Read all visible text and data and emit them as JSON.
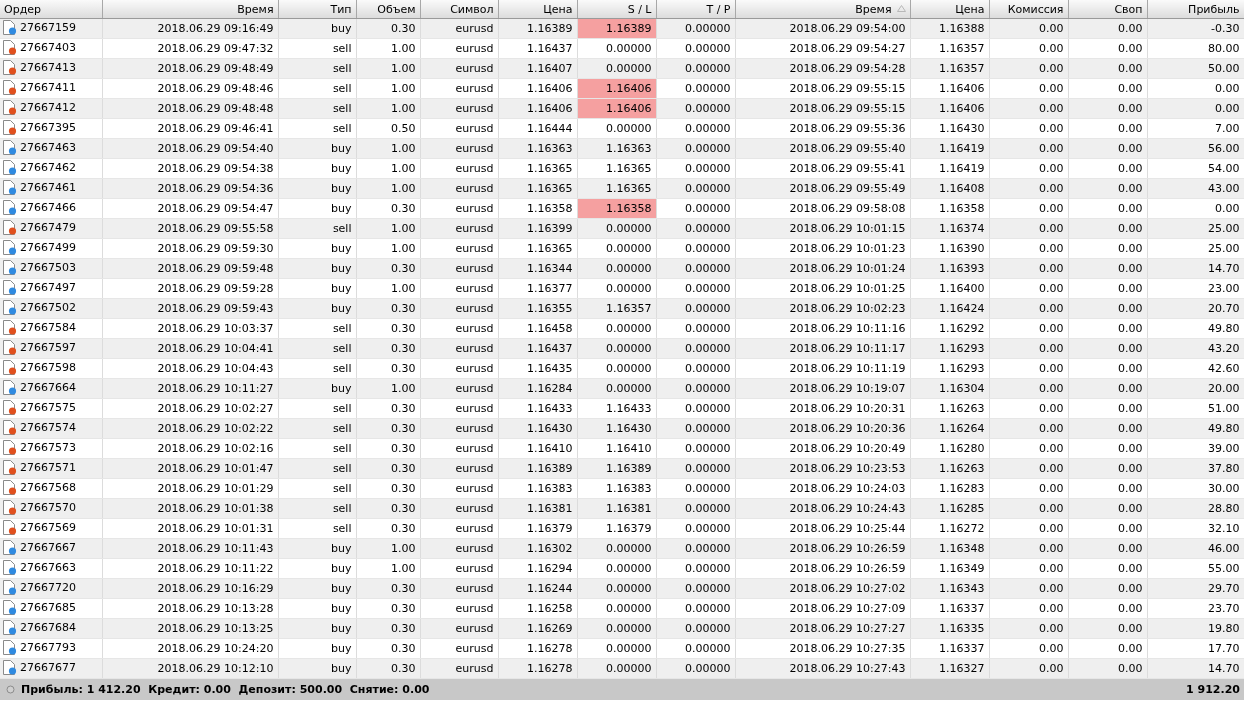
{
  "table": {
    "columns": [
      {
        "label": "Ордер",
        "sorted": false
      },
      {
        "label": "Время",
        "sorted": false
      },
      {
        "label": "Тип",
        "sorted": false
      },
      {
        "label": "Объем",
        "sorted": false
      },
      {
        "label": "Символ",
        "sorted": false
      },
      {
        "label": "Цена",
        "sorted": false
      },
      {
        "label": "S / L",
        "sorted": false
      },
      {
        "label": "T / P",
        "sorted": false
      },
      {
        "label": "Время",
        "sorted": true
      },
      {
        "label": "Цена",
        "sorted": false
      },
      {
        "label": "Комиссия",
        "sorted": false
      },
      {
        "label": "Своп",
        "sorted": false
      },
      {
        "label": "Прибыль",
        "sorted": false
      }
    ],
    "rows": [
      {
        "kind": "buy",
        "sl_hit": true,
        "cells": [
          "27667159",
          "2018.06.29 09:16:49",
          "buy",
          "0.30",
          "eurusd",
          "1.16389",
          "1.16389",
          "0.00000",
          "2018.06.29 09:54:00",
          "1.16388",
          "0.00",
          "0.00",
          "-0.30"
        ]
      },
      {
        "kind": "sell",
        "sl_hit": false,
        "cells": [
          "27667403",
          "2018.06.29 09:47:32",
          "sell",
          "1.00",
          "eurusd",
          "1.16437",
          "0.00000",
          "0.00000",
          "2018.06.29 09:54:27",
          "1.16357",
          "0.00",
          "0.00",
          "80.00"
        ]
      },
      {
        "kind": "sell",
        "sl_hit": false,
        "cells": [
          "27667413",
          "2018.06.29 09:48:49",
          "sell",
          "1.00",
          "eurusd",
          "1.16407",
          "0.00000",
          "0.00000",
          "2018.06.29 09:54:28",
          "1.16357",
          "0.00",
          "0.00",
          "50.00"
        ]
      },
      {
        "kind": "sell",
        "sl_hit": true,
        "cells": [
          "27667411",
          "2018.06.29 09:48:46",
          "sell",
          "1.00",
          "eurusd",
          "1.16406",
          "1.16406",
          "0.00000",
          "2018.06.29 09:55:15",
          "1.16406",
          "0.00",
          "0.00",
          "0.00"
        ]
      },
      {
        "kind": "sell",
        "sl_hit": true,
        "cells": [
          "27667412",
          "2018.06.29 09:48:48",
          "sell",
          "1.00",
          "eurusd",
          "1.16406",
          "1.16406",
          "0.00000",
          "2018.06.29 09:55:15",
          "1.16406",
          "0.00",
          "0.00",
          "0.00"
        ]
      },
      {
        "kind": "sell",
        "sl_hit": false,
        "cells": [
          "27667395",
          "2018.06.29 09:46:41",
          "sell",
          "0.50",
          "eurusd",
          "1.16444",
          "0.00000",
          "0.00000",
          "2018.06.29 09:55:36",
          "1.16430",
          "0.00",
          "0.00",
          "7.00"
        ]
      },
      {
        "kind": "buy",
        "sl_hit": false,
        "cells": [
          "27667463",
          "2018.06.29 09:54:40",
          "buy",
          "1.00",
          "eurusd",
          "1.16363",
          "1.16363",
          "0.00000",
          "2018.06.29 09:55:40",
          "1.16419",
          "0.00",
          "0.00",
          "56.00"
        ]
      },
      {
        "kind": "buy",
        "sl_hit": false,
        "cells": [
          "27667462",
          "2018.06.29 09:54:38",
          "buy",
          "1.00",
          "eurusd",
          "1.16365",
          "1.16365",
          "0.00000",
          "2018.06.29 09:55:41",
          "1.16419",
          "0.00",
          "0.00",
          "54.00"
        ]
      },
      {
        "kind": "buy",
        "sl_hit": false,
        "cells": [
          "27667461",
          "2018.06.29 09:54:36",
          "buy",
          "1.00",
          "eurusd",
          "1.16365",
          "1.16365",
          "0.00000",
          "2018.06.29 09:55:49",
          "1.16408",
          "0.00",
          "0.00",
          "43.00"
        ]
      },
      {
        "kind": "buy",
        "sl_hit": true,
        "cells": [
          "27667466",
          "2018.06.29 09:54:47",
          "buy",
          "0.30",
          "eurusd",
          "1.16358",
          "1.16358",
          "0.00000",
          "2018.06.29 09:58:08",
          "1.16358",
          "0.00",
          "0.00",
          "0.00"
        ]
      },
      {
        "kind": "sell",
        "sl_hit": false,
        "cells": [
          "27667479",
          "2018.06.29 09:55:58",
          "sell",
          "1.00",
          "eurusd",
          "1.16399",
          "0.00000",
          "0.00000",
          "2018.06.29 10:01:15",
          "1.16374",
          "0.00",
          "0.00",
          "25.00"
        ]
      },
      {
        "kind": "buy",
        "sl_hit": false,
        "cells": [
          "27667499",
          "2018.06.29 09:59:30",
          "buy",
          "1.00",
          "eurusd",
          "1.16365",
          "0.00000",
          "0.00000",
          "2018.06.29 10:01:23",
          "1.16390",
          "0.00",
          "0.00",
          "25.00"
        ]
      },
      {
        "kind": "buy",
        "sl_hit": false,
        "cells": [
          "27667503",
          "2018.06.29 09:59:48",
          "buy",
          "0.30",
          "eurusd",
          "1.16344",
          "0.00000",
          "0.00000",
          "2018.06.29 10:01:24",
          "1.16393",
          "0.00",
          "0.00",
          "14.70"
        ]
      },
      {
        "kind": "buy",
        "sl_hit": false,
        "cells": [
          "27667497",
          "2018.06.29 09:59:28",
          "buy",
          "1.00",
          "eurusd",
          "1.16377",
          "0.00000",
          "0.00000",
          "2018.06.29 10:01:25",
          "1.16400",
          "0.00",
          "0.00",
          "23.00"
        ]
      },
      {
        "kind": "buy",
        "sl_hit": false,
        "cells": [
          "27667502",
          "2018.06.29 09:59:43",
          "buy",
          "0.30",
          "eurusd",
          "1.16355",
          "1.16357",
          "0.00000",
          "2018.06.29 10:02:23",
          "1.16424",
          "0.00",
          "0.00",
          "20.70"
        ]
      },
      {
        "kind": "sell",
        "sl_hit": false,
        "cells": [
          "27667584",
          "2018.06.29 10:03:37",
          "sell",
          "0.30",
          "eurusd",
          "1.16458",
          "0.00000",
          "0.00000",
          "2018.06.29 10:11:16",
          "1.16292",
          "0.00",
          "0.00",
          "49.80"
        ]
      },
      {
        "kind": "sell",
        "sl_hit": false,
        "cells": [
          "27667597",
          "2018.06.29 10:04:41",
          "sell",
          "0.30",
          "eurusd",
          "1.16437",
          "0.00000",
          "0.00000",
          "2018.06.29 10:11:17",
          "1.16293",
          "0.00",
          "0.00",
          "43.20"
        ]
      },
      {
        "kind": "sell",
        "sl_hit": false,
        "cells": [
          "27667598",
          "2018.06.29 10:04:43",
          "sell",
          "0.30",
          "eurusd",
          "1.16435",
          "0.00000",
          "0.00000",
          "2018.06.29 10:11:19",
          "1.16293",
          "0.00",
          "0.00",
          "42.60"
        ]
      },
      {
        "kind": "buy",
        "sl_hit": false,
        "cells": [
          "27667664",
          "2018.06.29 10:11:27",
          "buy",
          "1.00",
          "eurusd",
          "1.16284",
          "0.00000",
          "0.00000",
          "2018.06.29 10:19:07",
          "1.16304",
          "0.00",
          "0.00",
          "20.00"
        ]
      },
      {
        "kind": "sell",
        "sl_hit": false,
        "cells": [
          "27667575",
          "2018.06.29 10:02:27",
          "sell",
          "0.30",
          "eurusd",
          "1.16433",
          "1.16433",
          "0.00000",
          "2018.06.29 10:20:31",
          "1.16263",
          "0.00",
          "0.00",
          "51.00"
        ]
      },
      {
        "kind": "sell",
        "sl_hit": false,
        "cells": [
          "27667574",
          "2018.06.29 10:02:22",
          "sell",
          "0.30",
          "eurusd",
          "1.16430",
          "1.16430",
          "0.00000",
          "2018.06.29 10:20:36",
          "1.16264",
          "0.00",
          "0.00",
          "49.80"
        ]
      },
      {
        "kind": "sell",
        "sl_hit": false,
        "cells": [
          "27667573",
          "2018.06.29 10:02:16",
          "sell",
          "0.30",
          "eurusd",
          "1.16410",
          "1.16410",
          "0.00000",
          "2018.06.29 10:20:49",
          "1.16280",
          "0.00",
          "0.00",
          "39.00"
        ]
      },
      {
        "kind": "sell",
        "sl_hit": false,
        "cells": [
          "27667571",
          "2018.06.29 10:01:47",
          "sell",
          "0.30",
          "eurusd",
          "1.16389",
          "1.16389",
          "0.00000",
          "2018.06.29 10:23:53",
          "1.16263",
          "0.00",
          "0.00",
          "37.80"
        ]
      },
      {
        "kind": "sell",
        "sl_hit": false,
        "cells": [
          "27667568",
          "2018.06.29 10:01:29",
          "sell",
          "0.30",
          "eurusd",
          "1.16383",
          "1.16383",
          "0.00000",
          "2018.06.29 10:24:03",
          "1.16283",
          "0.00",
          "0.00",
          "30.00"
        ]
      },
      {
        "kind": "sell",
        "sl_hit": false,
        "cells": [
          "27667570",
          "2018.06.29 10:01:38",
          "sell",
          "0.30",
          "eurusd",
          "1.16381",
          "1.16381",
          "0.00000",
          "2018.06.29 10:24:43",
          "1.16285",
          "0.00",
          "0.00",
          "28.80"
        ]
      },
      {
        "kind": "sell",
        "sl_hit": false,
        "cells": [
          "27667569",
          "2018.06.29 10:01:31",
          "sell",
          "0.30",
          "eurusd",
          "1.16379",
          "1.16379",
          "0.00000",
          "2018.06.29 10:25:44",
          "1.16272",
          "0.00",
          "0.00",
          "32.10"
        ]
      },
      {
        "kind": "buy",
        "sl_hit": false,
        "cells": [
          "27667667",
          "2018.06.29 10:11:43",
          "buy",
          "1.00",
          "eurusd",
          "1.16302",
          "0.00000",
          "0.00000",
          "2018.06.29 10:26:59",
          "1.16348",
          "0.00",
          "0.00",
          "46.00"
        ]
      },
      {
        "kind": "buy",
        "sl_hit": false,
        "cells": [
          "27667663",
          "2018.06.29 10:11:22",
          "buy",
          "1.00",
          "eurusd",
          "1.16294",
          "0.00000",
          "0.00000",
          "2018.06.29 10:26:59",
          "1.16349",
          "0.00",
          "0.00",
          "55.00"
        ]
      },
      {
        "kind": "buy",
        "sl_hit": false,
        "cells": [
          "27667720",
          "2018.06.29 10:16:29",
          "buy",
          "0.30",
          "eurusd",
          "1.16244",
          "0.00000",
          "0.00000",
          "2018.06.29 10:27:02",
          "1.16343",
          "0.00",
          "0.00",
          "29.70"
        ]
      },
      {
        "kind": "buy",
        "sl_hit": false,
        "cells": [
          "27667685",
          "2018.06.29 10:13:28",
          "buy",
          "0.30",
          "eurusd",
          "1.16258",
          "0.00000",
          "0.00000",
          "2018.06.29 10:27:09",
          "1.16337",
          "0.00",
          "0.00",
          "23.70"
        ]
      },
      {
        "kind": "buy",
        "sl_hit": false,
        "cells": [
          "27667684",
          "2018.06.29 10:13:25",
          "buy",
          "0.30",
          "eurusd",
          "1.16269",
          "0.00000",
          "0.00000",
          "2018.06.29 10:27:27",
          "1.16335",
          "0.00",
          "0.00",
          "19.80"
        ]
      },
      {
        "kind": "buy",
        "sl_hit": false,
        "cells": [
          "27667793",
          "2018.06.29 10:24:20",
          "buy",
          "0.30",
          "eurusd",
          "1.16278",
          "0.00000",
          "0.00000",
          "2018.06.29 10:27:35",
          "1.16337",
          "0.00",
          "0.00",
          "17.70"
        ]
      },
      {
        "kind": "buy",
        "sl_hit": false,
        "cells": [
          "27667677",
          "2018.06.29 10:12:10",
          "buy",
          "0.30",
          "eurusd",
          "1.16278",
          "0.00000",
          "0.00000",
          "2018.06.29 10:27:43",
          "1.16327",
          "0.00",
          "0.00",
          "14.70"
        ]
      }
    ]
  },
  "summary": {
    "text": "Прибыль: 1 412.20  Кредит: 0.00  Депозит: 500.00  Снятие: 0.00",
    "total": "1 912.20"
  }
}
